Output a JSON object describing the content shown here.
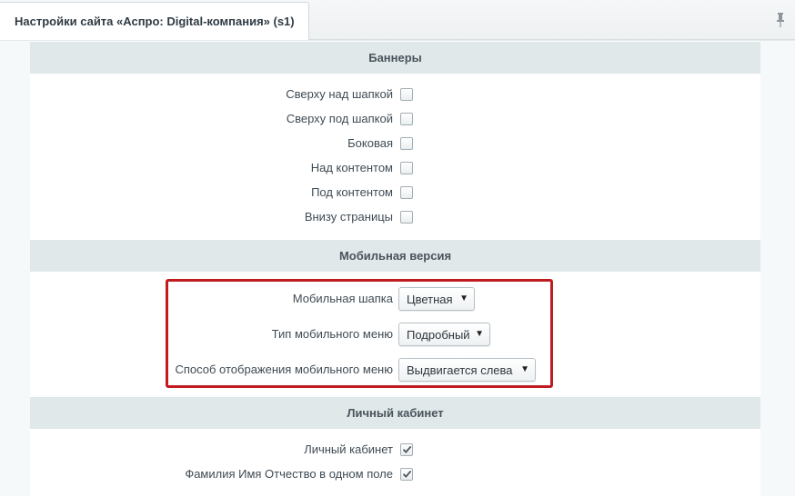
{
  "tab": {
    "title": "Настройки сайта «Аспро: Digital-компания» (s1)"
  },
  "sections": {
    "banners": {
      "title": "Баннеры",
      "items": [
        {
          "label": "Сверху над шапкой",
          "checked": false
        },
        {
          "label": "Сверху под шапкой",
          "checked": false
        },
        {
          "label": "Боковая",
          "checked": false
        },
        {
          "label": "Над контентом",
          "checked": false
        },
        {
          "label": "Под контентом",
          "checked": false
        },
        {
          "label": "Внизу страницы",
          "checked": false
        }
      ]
    },
    "mobile": {
      "title": "Мобильная версия",
      "items": [
        {
          "label": "Мобильная шапка",
          "value": "Цветная"
        },
        {
          "label": "Тип мобильного меню",
          "value": "Подробный"
        },
        {
          "label": "Способ отображения мобильного меню",
          "value": "Выдвигается слева"
        }
      ]
    },
    "cabinet": {
      "title": "Личный кабинет",
      "items": [
        {
          "label": "Личный кабинет",
          "checked": true
        },
        {
          "label": "Фамилия Имя Отчество в одном поле",
          "checked": true
        }
      ]
    }
  },
  "colors": {
    "highlight_border": "#c01b1f",
    "section_header_bg": "#e0e8ea"
  },
  "icons": {
    "pin": "pin-icon",
    "checkmark": "checkmark-icon",
    "dropdown": "dropdown-arrow-icon"
  }
}
